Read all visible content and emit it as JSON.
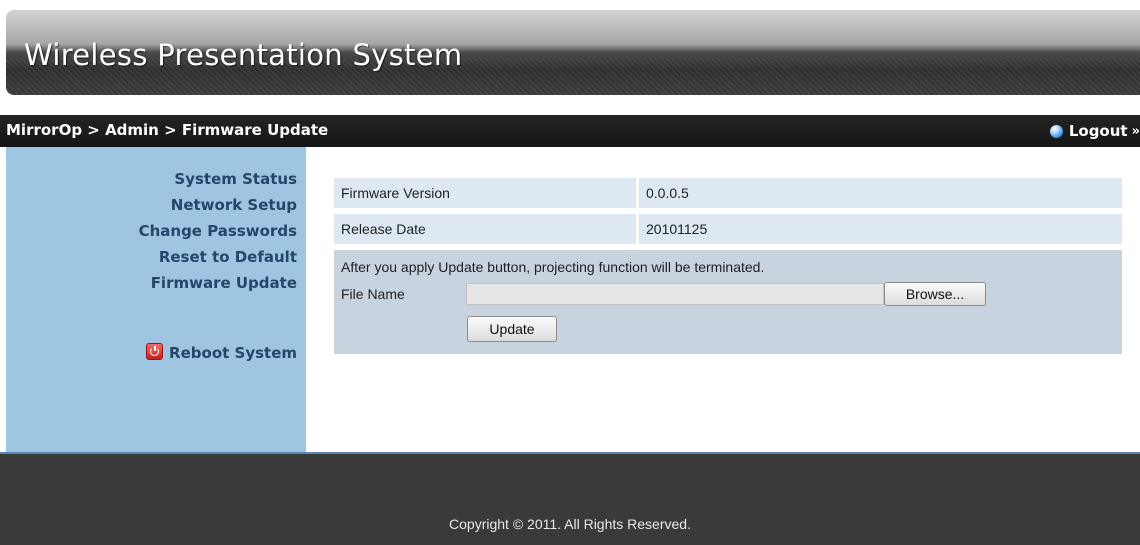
{
  "app": {
    "title": "Wireless Presentation System"
  },
  "nav": {
    "breadcrumb": "MirrorOp > Admin > Firmware Update",
    "logout_label": "Logout",
    "logout_arrows": "»"
  },
  "sidebar": {
    "items": [
      {
        "label": "System Status"
      },
      {
        "label": "Network Setup"
      },
      {
        "label": "Change Passwords"
      },
      {
        "label": "Reset to Default"
      },
      {
        "label": "Firmware Update"
      }
    ],
    "reboot_label": "Reboot System"
  },
  "firmware": {
    "version_label": "Firmware Version",
    "version_value": "0.0.0.5",
    "date_label": "Release Date",
    "date_value": "20101125",
    "notice": "After you apply Update button, projecting function will be terminated.",
    "file_label": "File Name",
    "file_value": "",
    "browse_label": "Browse...",
    "update_label": "Update"
  },
  "footer": {
    "copyright": "Copyright © 2011. All Rights Reserved."
  },
  "colors": {
    "sidebar_bg": "#9ec6e2",
    "sidebar_text": "#23466b",
    "nav_bg": "#1c1c1c",
    "row_bg": "#dde8f2",
    "panel_bg": "#c7d4df",
    "footer_bg": "#3a3a3a"
  }
}
